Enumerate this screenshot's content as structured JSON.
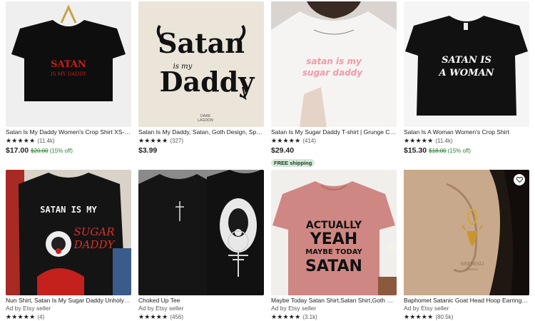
{
  "products": [
    {
      "title": "Satan Is My Daddy Women's Crop Shirt XS-3XL",
      "stars": "★★★★★",
      "reviews": "(11.4k)",
      "price": "$17.00",
      "original_price": "$20.00",
      "discount": "(15% off)",
      "image_text": [
        "SATAN",
        "IS MY DADDY"
      ]
    },
    {
      "title": "Satan Is My Daddy, Satan, Goth Design, Spooky B...",
      "stars": "★★★★★",
      "reviews": "(327)",
      "price": "$3.99",
      "image_text": [
        "Satan",
        "is my",
        "Daddy",
        "DARK",
        "LAGOON"
      ]
    },
    {
      "title": "Satan Is My Sugar Daddy T-shirt | Grunge Clothin...",
      "stars": "★★★★★",
      "reviews": "(414)",
      "price": "$29.40",
      "badge": "FREE shipping",
      "image_text": [
        "satan is my",
        "sugar daddy"
      ]
    },
    {
      "title": "Satan Is A Woman Women's Crop Shirt",
      "stars": "★★★★★",
      "reviews": "(11.4k)",
      "price": "$15.30",
      "original_price": "$18.00",
      "discount": "(15% off)",
      "image_text": [
        "SATAN IS",
        "A WOMAN"
      ]
    },
    {
      "title": "Nun Shirt, Satan Is My Sugar Daddy Unholy Nun ...",
      "ad": "Ad by Etsy seller",
      "stars": "★★★★★",
      "reviews": "(4)",
      "image_text": [
        "SATAN IS MY",
        "SUGAR",
        "DADDY"
      ]
    },
    {
      "title": "Choked Up Tee",
      "ad": "Ad by Etsy seller",
      "stars": "★★★★★",
      "reviews": "(456)",
      "image_text": []
    },
    {
      "title": "Maybe Today Satan Shirt,Satan Shirt,Goth Shirt,E...",
      "ad": "Ad by Etsy seller",
      "stars": "★★★★★",
      "reviews": "(3.1k)",
      "image_text": [
        "ACTUALLY",
        "YEAH",
        "MAYBE TODAY",
        "SATAN"
      ]
    },
    {
      "title": "Baphomet Satanic Goat Head Hoop Earrings, Sat...",
      "ad": "Ad by Etsy seller",
      "stars": "★★★★★",
      "reviews": "(80.5k)",
      "image_text": [
        "SHEMISLI",
        "JEWELS"
      ]
    }
  ]
}
